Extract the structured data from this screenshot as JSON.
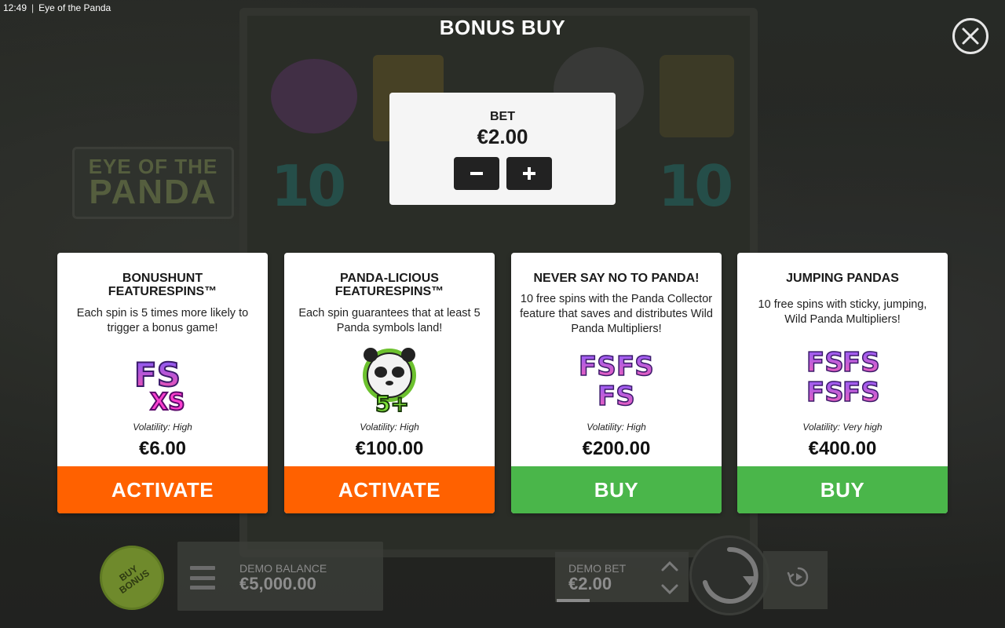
{
  "status_bar": {
    "time": "12:49",
    "separator": "|",
    "window_title": "Eye of the Panda"
  },
  "background": {
    "logo_line1": "EYE OF THE",
    "logo_line2": "PANDA",
    "reel_number": "10"
  },
  "modal": {
    "title": "BONUS BUY",
    "close_icon": "close-icon"
  },
  "bet_panel": {
    "label": "BET",
    "value": "€2.00",
    "decrease_icon": "minus-icon",
    "increase_icon": "plus-icon"
  },
  "offers": [
    {
      "title": "BONUSHUNT FEATURESPINS™",
      "description": "Each spin is 5 times more likely to trigger a bonus game!",
      "art_icon": "fs-xs-symbol",
      "art_text_1": "FS",
      "art_text_2": "XS",
      "volatility": "Volatility: High",
      "price": "€6.00",
      "action": "ACTIVATE",
      "action_color": "#ff6100"
    },
    {
      "title": "PANDA-LICIOUS FEATURESPINS™",
      "description": "Each spin guarantees that at least 5 Panda symbols land!",
      "art_icon": "panda-5plus-symbol",
      "art_text_1": "5+",
      "volatility": "Volatility: High",
      "price": "€100.00",
      "action": "ACTIVATE",
      "action_color": "#ff6100"
    },
    {
      "title": "NEVER SAY NO TO PANDA!",
      "description": "10 free spins with the Panda Collector feature that saves and distributes Wild Panda Multipliers!",
      "art_icon": "fs-triple-symbol",
      "art_text_1": "FS",
      "volatility": "Volatility: High",
      "price": "€200.00",
      "action": "BUY",
      "action_color": "#4ab64a"
    },
    {
      "title": "JUMPING PANDAS",
      "description": "10 free spins with sticky, jumping, Wild Panda Multipliers!",
      "art_icon": "fs-quad-symbol",
      "art_text_1": "FS",
      "volatility": "Volatility: Very high",
      "price": "€400.00",
      "action": "BUY",
      "action_color": "#4ab64a"
    }
  ],
  "controls": {
    "buy_bonus_label_1": "BUY",
    "buy_bonus_label_2": "BONUS",
    "menu_icon": "hamburger-menu-icon",
    "balance_label": "DEMO BALANCE",
    "balance_value": "€5,000.00",
    "bet_label": "DEMO BET",
    "bet_value": "€2.00",
    "bet_arrows_icon": "chevron-up-down-icon",
    "spin_icon": "spin-arrow-icon",
    "autoplay_icon": "autoplay-icon"
  }
}
